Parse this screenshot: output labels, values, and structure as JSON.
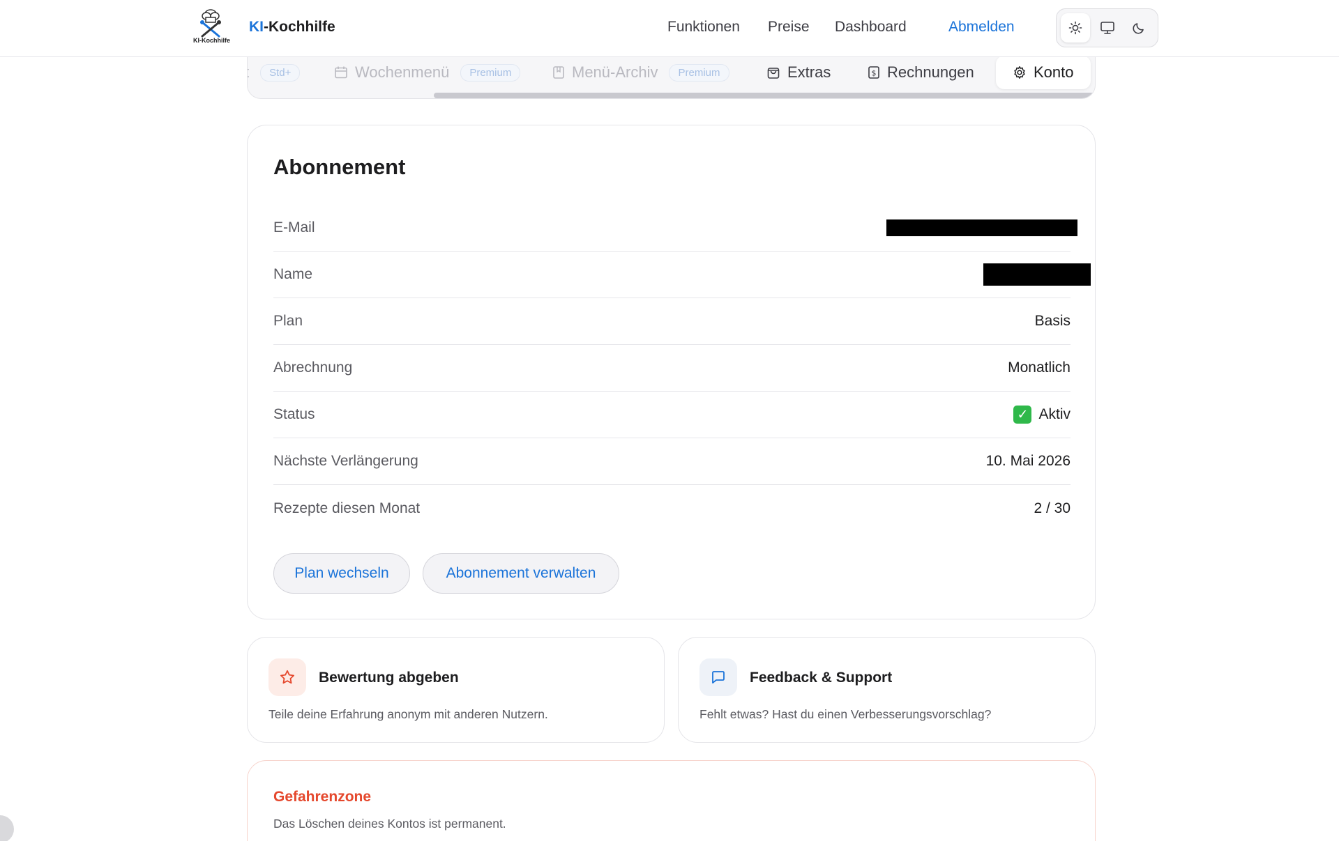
{
  "header": {
    "brand_prefix": "KI",
    "brand_suffix": "-Kochhilfe",
    "logo_text": "KI-Kochhilfe",
    "nav": [
      "Funktionen",
      "Preise",
      "Dashboard",
      "Abmelden"
    ],
    "accent_color": "#1a73d9",
    "theme_icons": [
      "sun-icon",
      "monitor-icon",
      "moon-icon"
    ]
  },
  "tabs": {
    "items": [
      {
        "label": "t",
        "badge": "Std+",
        "state": "disabled"
      },
      {
        "label": "Wochenmenü",
        "badge": "Premium",
        "icon": "calendar-icon",
        "state": "disabled"
      },
      {
        "label": "Menü-Archiv",
        "badge": "Premium",
        "icon": "bookmark-icon",
        "state": "disabled"
      },
      {
        "label": "Extras",
        "icon": "bag-icon",
        "state": "enabled"
      },
      {
        "label": "Rechnungen",
        "icon": "receipt-icon",
        "state": "enabled"
      },
      {
        "label": "Konto",
        "icon": "gear-icon",
        "state": "active"
      }
    ]
  },
  "subscription": {
    "title": "Abonnement",
    "rows": [
      {
        "label": "E-Mail",
        "value": ""
      },
      {
        "label": "Name",
        "value": ""
      },
      {
        "label": "Plan",
        "value": "Basis"
      },
      {
        "label": "Abrechnung",
        "value": "Monatlich"
      },
      {
        "label": "Status",
        "value": "Aktiv",
        "icon": "check-icon"
      },
      {
        "label": "Nächste Verlängerung",
        "value": "10. Mai 2026"
      },
      {
        "label": "Rezepte diesen Monat",
        "value": "2 / 30"
      }
    ],
    "buttons": {
      "change_plan": "Plan wechseln",
      "manage": "Abonnement verwalten"
    }
  },
  "cards": {
    "rating": {
      "title": "Bewertung abgeben",
      "desc": "Teile deine Erfahrung anonym mit anderen Nutzern.",
      "icon": "star-icon",
      "icon_color": "#e5482d"
    },
    "feedback": {
      "title": "Feedback & Support",
      "desc": "Fehlt etwas? Hast du einen Verbesserungsvorschlag?",
      "icon": "chat-icon",
      "icon_color": "#1a73d9"
    }
  },
  "danger": {
    "title": "Gefahrenzone",
    "desc": "Das Löschen deines Kontos ist permanent.",
    "color": "#e5482d"
  }
}
